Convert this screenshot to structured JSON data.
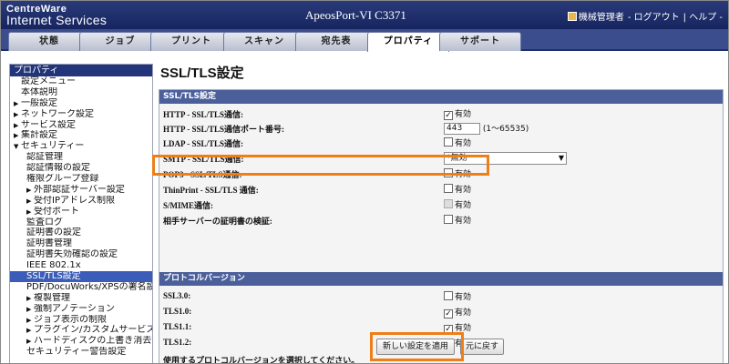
{
  "header": {
    "logo_line1": "CentreWare",
    "logo_line2": "Internet Services",
    "device": "ApeosPort-VI C3371",
    "user": "機械管理者",
    "logout": "- ログアウト",
    "help": "| ヘルプ -"
  },
  "tabs": [
    {
      "label": "状態"
    },
    {
      "label": "ジョブ"
    },
    {
      "label": "プリント"
    },
    {
      "label": "スキャン"
    },
    {
      "label": "宛先表"
    },
    {
      "label": "プロパティ"
    },
    {
      "label": "サポート"
    }
  ],
  "sidebar": {
    "title": "プロパティ",
    "items": [
      {
        "label": "設定メニュー",
        "indent": 0,
        "tri": ""
      },
      {
        "label": "本体説明",
        "indent": 0,
        "tri": ""
      },
      {
        "label": "一般設定",
        "indent": 0,
        "tri": "▶"
      },
      {
        "label": "ネットワーク設定",
        "indent": 0,
        "tri": "▶"
      },
      {
        "label": "サービス設定",
        "indent": 0,
        "tri": "▶"
      },
      {
        "label": "集計設定",
        "indent": 0,
        "tri": "▶"
      },
      {
        "label": "セキュリティー",
        "indent": 0,
        "tri": "▼"
      },
      {
        "label": "認証管理",
        "indent": 1,
        "tri": ""
      },
      {
        "label": "認証情報の設定",
        "indent": 1,
        "tri": ""
      },
      {
        "label": "権限グループ登録",
        "indent": 1,
        "tri": ""
      },
      {
        "label": "外部認証サーバー設定",
        "indent": 1,
        "tri": "▶"
      },
      {
        "label": "受付IPアドレス制限",
        "indent": 1,
        "tri": "▶"
      },
      {
        "label": "受付ポート",
        "indent": 1,
        "tri": "▶"
      },
      {
        "label": "監査ログ",
        "indent": 1,
        "tri": ""
      },
      {
        "label": "証明書の設定",
        "indent": 1,
        "tri": ""
      },
      {
        "label": "証明書管理",
        "indent": 1,
        "tri": ""
      },
      {
        "label": "証明書失効確認の設定",
        "indent": 1,
        "tri": ""
      },
      {
        "label": "IEEE 802.1x",
        "indent": 1,
        "tri": ""
      },
      {
        "label": "SSL/TLS設定",
        "indent": 1,
        "tri": "",
        "selected": true
      },
      {
        "label": "PDF/DocuWorks/XPSの署名設定",
        "indent": 1,
        "tri": ""
      },
      {
        "label": "複製管理",
        "indent": 1,
        "tri": "▶"
      },
      {
        "label": "強制アノテーション",
        "indent": 1,
        "tri": "▶"
      },
      {
        "label": "ジョブ表示の制限",
        "indent": 1,
        "tri": "▶"
      },
      {
        "label": "プラグイン/カスタムサービス設定",
        "indent": 1,
        "tri": "▶"
      },
      {
        "label": "ハードディスクの上書き消去設定",
        "indent": 1,
        "tri": "▶"
      },
      {
        "label": "セキュリティー警告設定",
        "indent": 1,
        "tri": ""
      }
    ]
  },
  "main": {
    "title": "SSL/TLS設定",
    "section1": "SSL/TLS設定",
    "rows": [
      {
        "label": "HTTP - SSL/TLS通信:",
        "type": "checkbox",
        "checked": true,
        "text": "有効"
      },
      {
        "label": "HTTP - SSL/TLS通信ポート番号:",
        "type": "text",
        "value": "443",
        "hint": "(1〜65535)"
      },
      {
        "label": "LDAP - SSL/TLS通信:",
        "type": "checkbox",
        "checked": false,
        "text": "有効"
      },
      {
        "label": "SMTP - SSL/TLS通信:",
        "type": "select",
        "value": "*無効"
      },
      {
        "label": "POP3 - SSL/TLS通信:",
        "type": "checkbox",
        "checked": false,
        "text": "有効"
      },
      {
        "label": "ThinPrint - SSL/TLS 通信:",
        "type": "checkbox",
        "checked": false,
        "text": "有効"
      },
      {
        "label": "S/MIME通信:",
        "type": "checkbox",
        "checked": false,
        "disabled": true,
        "text": "有効"
      },
      {
        "label": "相手サーバーの証明書の検証:",
        "type": "checkbox",
        "checked": false,
        "text": "有効"
      }
    ],
    "section2": "プロトコルバージョン",
    "proto_rows": [
      {
        "label": "SSL3.0:",
        "checked": false,
        "text": "有効"
      },
      {
        "label": "TLS1.0:",
        "checked": true,
        "text": "有効"
      },
      {
        "label": "TLS1.1:",
        "checked": true,
        "text": "有効"
      },
      {
        "label": "TLS1.2:",
        "checked": true,
        "text": "有効"
      }
    ],
    "note": "使用するプロトコルバージョンを選択してください。",
    "apply_button": "新しい設定を適用",
    "undo_button": "元に戻す"
  },
  "colors": {
    "highlight": "#f07e17",
    "header": "#1e2f6e",
    "selected": "#3b5cb8"
  }
}
